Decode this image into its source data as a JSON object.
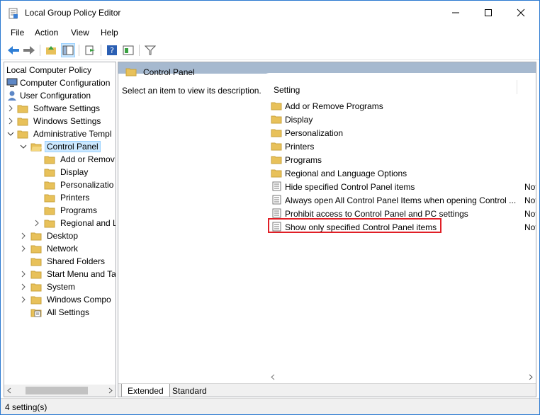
{
  "window": {
    "title": "Local Group Policy Editor",
    "controls": [
      "minimize",
      "maximize",
      "close"
    ]
  },
  "menubar": {
    "items": [
      "File",
      "Action",
      "View",
      "Help"
    ]
  },
  "toolbar": {
    "buttons": [
      "back-icon",
      "forward-icon",
      "up-folder-icon",
      "show-hide-tree-icon",
      "export-list-icon",
      "help-icon",
      "properties-view-icon",
      "filter-icon"
    ]
  },
  "tree": {
    "items": [
      {
        "label": "Local Computer Policy"
      },
      {
        "label": "Computer Configuration"
      },
      {
        "label": "User Configuration"
      },
      {
        "label": "Software Settings"
      },
      {
        "label": "Windows Settings"
      },
      {
        "label": "Administrative Templ"
      },
      {
        "label": "Control Panel"
      },
      {
        "label": "Add or Remov"
      },
      {
        "label": "Display"
      },
      {
        "label": "Personalizatio"
      },
      {
        "label": "Printers"
      },
      {
        "label": "Programs"
      },
      {
        "label": "Regional and L"
      },
      {
        "label": "Desktop"
      },
      {
        "label": "Network"
      },
      {
        "label": "Shared Folders"
      },
      {
        "label": "Start Menu and Ta"
      },
      {
        "label": "System"
      },
      {
        "label": "Windows Compo"
      },
      {
        "label": "All Settings"
      }
    ]
  },
  "content": {
    "header_title": "Control Panel",
    "description": "Select an item to view its description.",
    "column_header": "Setting",
    "rows": [
      {
        "label": "Add or Remove Programs",
        "state": ""
      },
      {
        "label": "Display",
        "state": ""
      },
      {
        "label": "Personalization",
        "state": ""
      },
      {
        "label": "Printers",
        "state": ""
      },
      {
        "label": "Programs",
        "state": ""
      },
      {
        "label": "Regional and Language Options",
        "state": ""
      },
      {
        "label": "Hide specified Control Panel items",
        "state": "Not"
      },
      {
        "label": "Always open All Control Panel Items when opening Control ...",
        "state": "Not"
      },
      {
        "label": "Prohibit access to Control Panel and PC settings",
        "state": "Not"
      },
      {
        "label": "Show only specified Control Panel items",
        "state": "Not"
      }
    ]
  },
  "tabs": {
    "extended": "Extended",
    "standard": "Standard"
  },
  "status": {
    "text": "4 setting(s)"
  },
  "colors": {
    "highlight_border": "#e01f26",
    "selection": "#cce8ff",
    "header_band": "#a6b9cf",
    "folder": "#e8c15a"
  }
}
